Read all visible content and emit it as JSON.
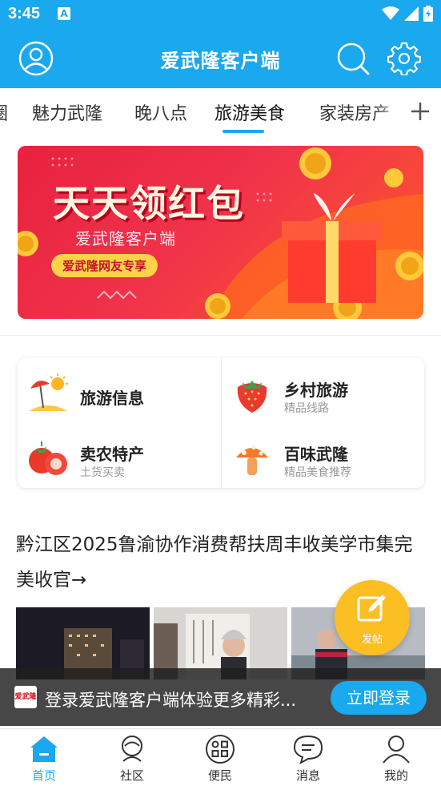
{
  "status_bar": {
    "time": "3:45",
    "notification_icon": "A"
  },
  "header": {
    "title": "爱武隆客户端",
    "left_icon": "user-icon",
    "right_icons": [
      "search-icon",
      "gear-icon"
    ]
  },
  "tabs": {
    "items": [
      {
        "label": "圈"
      },
      {
        "label": "魅力武隆"
      },
      {
        "label": "晚八点"
      },
      {
        "label": "旅游美食"
      },
      {
        "label": "家装房产"
      }
    ],
    "active": "旅游美食",
    "add_icon": "plus-icon"
  },
  "banner": {
    "title": "天天领红包",
    "subtitle": "爱武隆客户端",
    "tag": "爱武隆网友专享"
  },
  "quick_links": [
    {
      "title": "旅游信息",
      "subtitle": "",
      "icon": "beach-icon"
    },
    {
      "title": "乡村旅游",
      "subtitle": "精品线路",
      "icon": "strawberry-icon"
    },
    {
      "title": "卖农特产",
      "subtitle": "土货买卖",
      "icon": "tomato-icon"
    },
    {
      "title": "百味武隆",
      "subtitle": "精品美食推荐",
      "icon": "mushroom-icon"
    }
  ],
  "article": {
    "title": "黔江区2025鲁渝协作消费帮扶周丰收美学市集完美收官→"
  },
  "fab": {
    "label": "发帖",
    "icon": "edit-icon"
  },
  "login_bar": {
    "logo_text": "爱武隆",
    "text": "登录爱武隆客户端体验更多精彩...",
    "button": "立即登录"
  },
  "bottom_nav": [
    {
      "label": "首页",
      "icon": "home-icon",
      "active": true
    },
    {
      "label": "社区",
      "icon": "community-icon",
      "active": false
    },
    {
      "label": "便民",
      "icon": "services-icon",
      "active": false
    },
    {
      "label": "消息",
      "icon": "message-icon",
      "active": false
    },
    {
      "label": "我的",
      "icon": "profile-icon",
      "active": false
    }
  ],
  "colors": {
    "primary": "#1aa8ee",
    "banner_red": "#e8213f",
    "fab_yellow": "#fbbf23"
  }
}
